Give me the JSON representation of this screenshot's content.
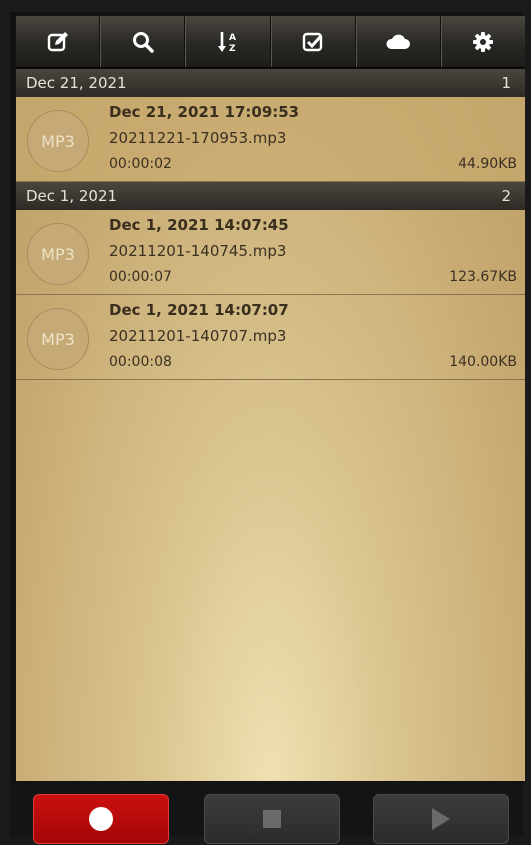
{
  "toolbar": {
    "buttons": [
      {
        "icon": "edit-icon"
      },
      {
        "icon": "search-icon"
      },
      {
        "icon": "sort-az-icon"
      },
      {
        "icon": "checkbox-icon"
      },
      {
        "icon": "cloud-icon"
      },
      {
        "icon": "gear-icon"
      }
    ]
  },
  "groups": [
    {
      "date": "Dec 21, 2021",
      "count": "1",
      "recordings": [
        {
          "badge": "MP3",
          "title": "Dec 21, 2021 17:09:53",
          "file": "20211221-170953.mp3",
          "duration": "00:00:02",
          "size": "44.90KB"
        }
      ]
    },
    {
      "date": "Dec 1, 2021",
      "count": "2",
      "recordings": [
        {
          "badge": "MP3",
          "title": "Dec 1, 2021 14:07:45",
          "file": "20211201-140745.mp3",
          "duration": "00:00:07",
          "size": "123.67KB"
        },
        {
          "badge": "MP3",
          "title": "Dec 1, 2021 14:07:07",
          "file": "20211201-140707.mp3",
          "duration": "00:00:08",
          "size": "140.00KB"
        }
      ]
    }
  ],
  "controls": {
    "record_color": "#c00a0a"
  }
}
